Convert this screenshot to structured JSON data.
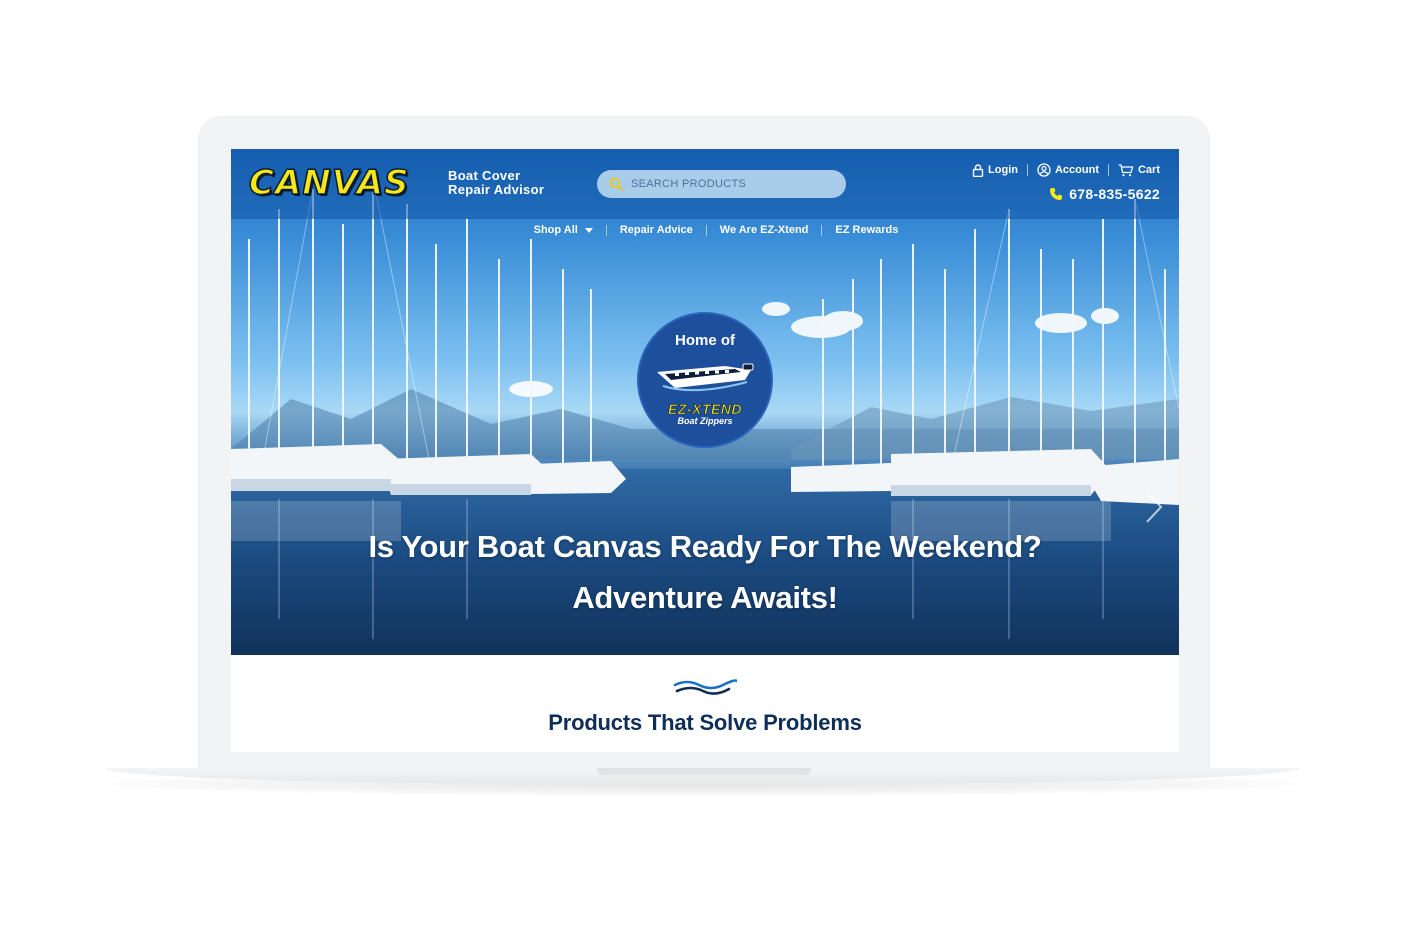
{
  "header": {
    "logo_word": "CANVAS",
    "logo_tagline_1": "Boat Cover",
    "logo_tagline_2": "Repair Advisor",
    "search_placeholder": "SEARCH PRODUCTS",
    "login_label": "Login",
    "account_label": "Account",
    "cart_label": "Cart",
    "phone": "678-835-5622"
  },
  "nav": {
    "items": [
      {
        "label": "Shop All",
        "has_dropdown": true
      },
      {
        "label": "Repair Advice"
      },
      {
        "label": "We Are EZ-Xtend"
      },
      {
        "label": "EZ Rewards"
      }
    ]
  },
  "hero": {
    "badge_top": "Home of",
    "badge_brand": "EZ-XTEND",
    "badge_sub": "Boat Zippers",
    "headline_1": "Is Your Boat Canvas Ready For The Weekend?",
    "headline_2": "Adventure Awaits!"
  },
  "section": {
    "title": "Products That Solve Problems"
  },
  "icons": {
    "search": "search-icon",
    "login": "lock-icon",
    "account": "user-icon",
    "cart": "cart-icon",
    "phone": "phone-icon",
    "dropdown": "caret-down-icon",
    "slider_next": "chevron-right-icon",
    "wave": "wave-icon"
  },
  "colors": {
    "brand_yellow": "#f6e61a",
    "brand_navy": "#0f2e57",
    "header_blue": "#1258a8",
    "badge_blue": "#1e4f9c"
  }
}
